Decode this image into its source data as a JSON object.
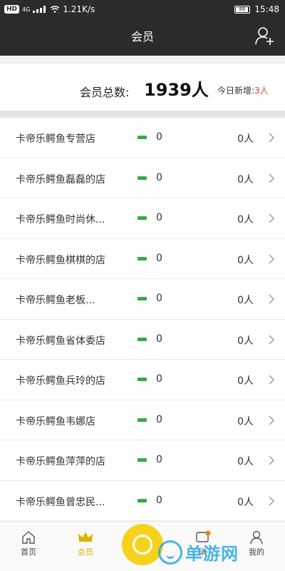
{
  "status_bar": {
    "hd": "HD",
    "net": "4G",
    "speed": "1.21K/s",
    "battery": "88",
    "time": "15:48"
  },
  "header": {
    "title": "会员"
  },
  "summary": {
    "total_label": "会员总数:",
    "total_value": "1939人",
    "today_label": "今日新增:",
    "today_value": "3人"
  },
  "stores": [
    {
      "name": "卡帝乐鳄鱼专营店",
      "count": "0",
      "people": "0人"
    },
    {
      "name": "卡帝乐鳄鱼磊磊的店",
      "count": "0",
      "people": "0人"
    },
    {
      "name": "卡帝乐鳄鱼时尚休...",
      "count": "0",
      "people": "0人"
    },
    {
      "name": "卡帝乐鳄鱼棋棋的店",
      "count": "0",
      "people": "0人"
    },
    {
      "name": "卡帝乐鳄鱼老板...",
      "count": "0",
      "people": "0人"
    },
    {
      "name": "卡帝乐鳄鱼省体委店",
      "count": "0",
      "people": "0人"
    },
    {
      "name": "卡帝乐鳄鱼兵玲的店",
      "count": "0",
      "people": "0人"
    },
    {
      "name": "卡帝乐鳄鱼韦娜店",
      "count": "0",
      "people": "0人"
    },
    {
      "name": "卡帝乐鳄鱼萍萍的店",
      "count": "0",
      "people": "0人"
    },
    {
      "name": "卡帝乐鳄鱼曾忠民...",
      "count": "0",
      "people": "0人"
    }
  ],
  "tabs": {
    "home": "首页",
    "members": "会员",
    "msg": "消",
    "mine": "我的"
  },
  "watermark": "单游网",
  "colors": {
    "header_bg": "#2b2b2b",
    "accent": "#f7d21c",
    "bar": "#3aa844",
    "highlight": "#e53935"
  }
}
